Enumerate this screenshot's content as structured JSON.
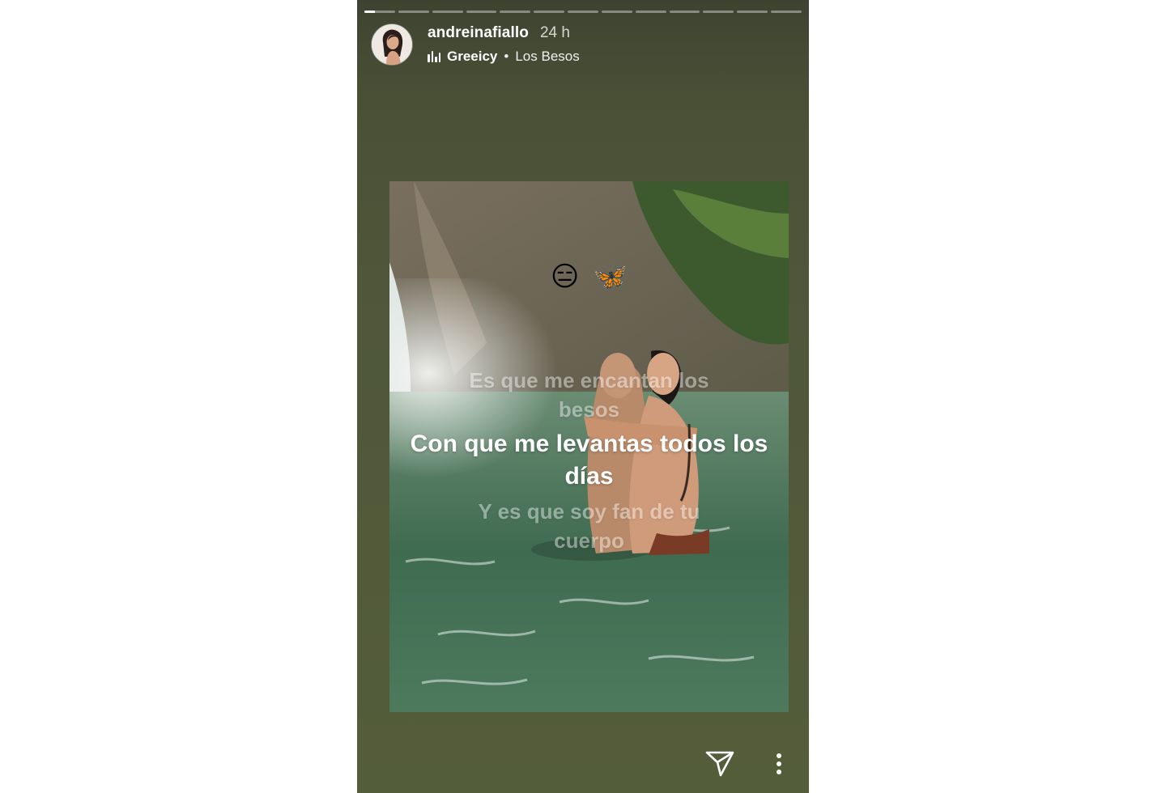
{
  "story": {
    "segments_total": 13,
    "current_segment_index": 0,
    "current_segment_progress": 0.35,
    "background_color": "#50573a"
  },
  "header": {
    "username": "andreinafiallo",
    "time_ago": "24 h",
    "music": {
      "icon": "music-bars-icon",
      "artist": "Greeicy",
      "separator": "•",
      "song": "Los Besos"
    }
  },
  "content": {
    "emojis": [
      "😑",
      "🦋"
    ],
    "lyrics": [
      {
        "text": "Es que me encantan los besos",
        "state": "previous"
      },
      {
        "text": "Con que me levantas todos los días",
        "state": "current"
      },
      {
        "text": "Y es que soy fan de tu cuerpo",
        "state": "next"
      }
    ]
  },
  "footer": {
    "send_icon": "paper-plane-icon",
    "more_icon": "vertical-dots-icon"
  }
}
